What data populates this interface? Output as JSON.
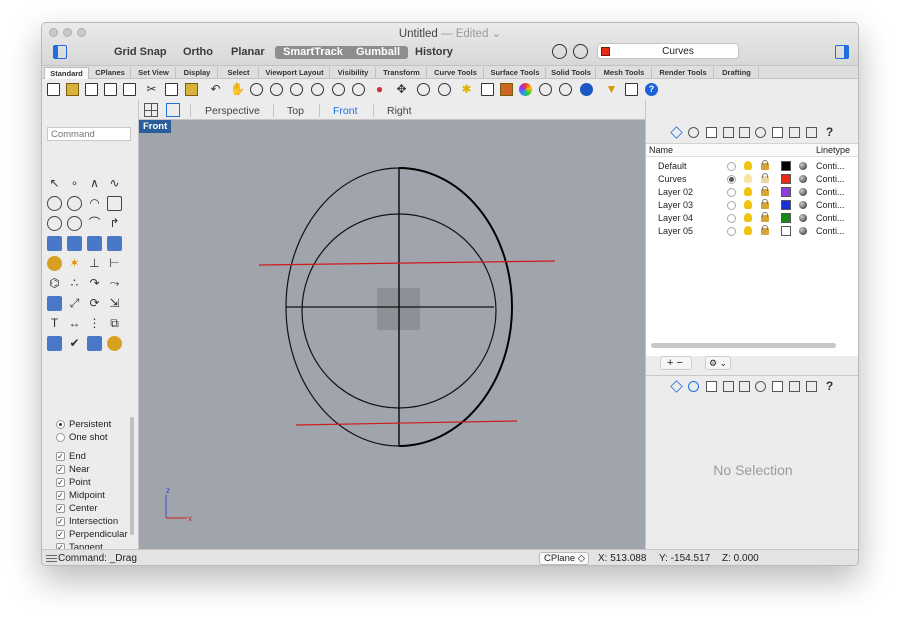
{
  "window": {
    "title": "Untitled",
    "title_status": "— Edited ⌄"
  },
  "toolbar": {
    "grid_snap": "Grid Snap",
    "ortho": "Ortho",
    "planar": "Planar",
    "smarttrack": "SmartTrack",
    "gumball": "Gumball",
    "history": "History",
    "current_layer": "Curves",
    "current_layer_color": "#e52b10"
  },
  "tabs": [
    "Standard",
    "CPlanes",
    "Set View",
    "Display",
    "Select",
    "Viewport Layout",
    "Visibility",
    "Transform",
    "Curve Tools",
    "Surface Tools",
    "Solid Tools",
    "Mesh Tools",
    "Render Tools",
    "Drafting"
  ],
  "command": {
    "placeholder": "Command"
  },
  "osnaps": {
    "mode": [
      {
        "label": "Persistent",
        "selected": true
      },
      {
        "label": "One shot",
        "selected": false
      }
    ],
    "items": [
      {
        "label": "End",
        "checked": true
      },
      {
        "label": "Near",
        "checked": true
      },
      {
        "label": "Point",
        "checked": true
      },
      {
        "label": "Midpoint",
        "checked": true
      },
      {
        "label": "Center",
        "checked": true
      },
      {
        "label": "Intersection",
        "checked": true
      },
      {
        "label": "Perpendicular",
        "checked": true
      },
      {
        "label": "Tangent",
        "checked": true
      }
    ]
  },
  "viewport_tabs": [
    "Perspective",
    "Top",
    "Front",
    "Right"
  ],
  "viewport": {
    "label": "Front",
    "axis_z": "z",
    "axis_x": "x"
  },
  "layers": {
    "header_name": "Name",
    "header_linetype": "Linetype",
    "rows": [
      {
        "name": "Default",
        "color": "#000000",
        "current": false,
        "linetype": "Conti..."
      },
      {
        "name": "Curves",
        "color": "#e52b10",
        "current": true,
        "linetype": "Conti..."
      },
      {
        "name": "Layer 02",
        "color": "#8e3dd8",
        "current": false,
        "linetype": "Conti..."
      },
      {
        "name": "Layer 03",
        "color": "#1a2fd8",
        "current": false,
        "linetype": "Conti..."
      },
      {
        "name": "Layer 04",
        "color": "#178a17",
        "current": false,
        "linetype": "Conti..."
      },
      {
        "name": "Layer 05",
        "color": "#ffffff",
        "current": false,
        "linetype": "Conti..."
      }
    ],
    "add_remove": "+ −",
    "gear": "⚙ ⌄"
  },
  "properties": {
    "empty_message": "No Selection"
  },
  "status": {
    "command": "Command: _Drag",
    "cplane": "CPlane",
    "x": "X: 513.088",
    "y": "Y: -154.517",
    "z": "Z: 0.000"
  }
}
